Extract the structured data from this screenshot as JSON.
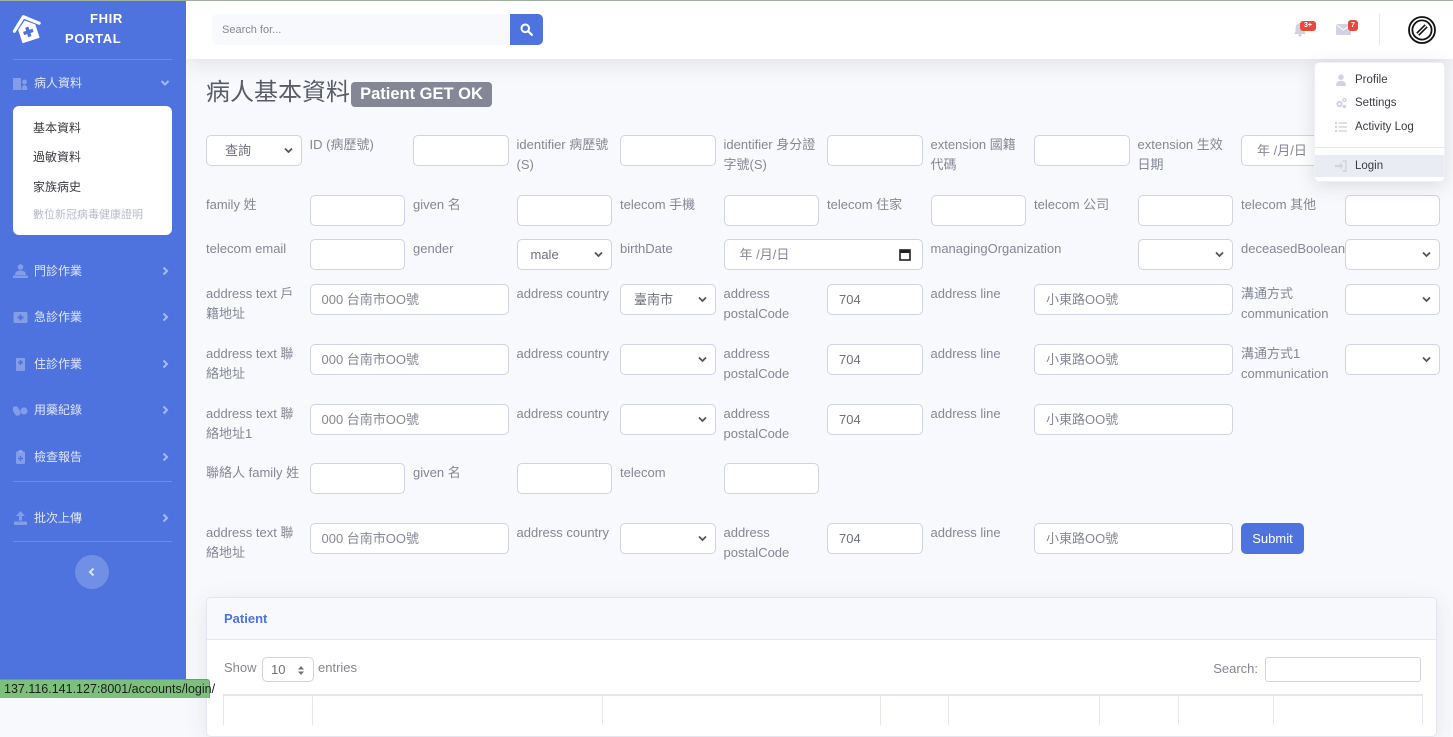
{
  "browser": {
    "status_url": "137.116.141.127:8001/accounts/login/"
  },
  "sidebar": {
    "brand": {
      "line1": "FHIR",
      "line2": "PORTAL",
      "icon": "clinic-medical-icon"
    },
    "patient_section": {
      "label": "病人資料",
      "icon": "hospital-user-icon",
      "expanded": true,
      "items": [
        {
          "label": "基本資料"
        },
        {
          "label": "過敏資料"
        },
        {
          "label": "家族病史"
        },
        {
          "label": "數位新冠病毒健康證明",
          "disabled": true
        }
      ]
    },
    "nav": [
      {
        "label": "門診作業",
        "icon": "user-injured-icon"
      },
      {
        "label": "急診作業",
        "icon": "medkit-icon"
      },
      {
        "label": "住診作業",
        "icon": "hospital-icon"
      },
      {
        "label": "用藥紀錄",
        "icon": "pills-icon"
      },
      {
        "label": "檢查報告",
        "icon": "file-medical-icon"
      },
      {
        "label": "批次上傳",
        "icon": "upload-icon"
      }
    ],
    "toggle_icon": "chevron-left-icon"
  },
  "topbar": {
    "search": {
      "placeholder": "Search for...",
      "value": ""
    },
    "alerts": {
      "icon": "bell-icon",
      "badge": "3+"
    },
    "messages": {
      "icon": "envelope-icon",
      "badge": "7"
    },
    "user_icon": "ban-icon",
    "user_menu": {
      "items": [
        {
          "label": "Profile",
          "icon": "user-icon"
        },
        {
          "label": "Settings",
          "icon": "cogs-icon"
        },
        {
          "label": "Activity Log",
          "icon": "list-icon"
        },
        {
          "label": "Login",
          "icon": "sign-in-icon",
          "active": true
        }
      ]
    }
  },
  "page": {
    "title": "病人基本資料",
    "status_badge": "Patient GET OK"
  },
  "form": {
    "mode": {
      "value": "查詢"
    },
    "id": {
      "label": "ID (病歷號)",
      "value": ""
    },
    "identifier_mrn": {
      "label": "identifier 病歷號(S)",
      "value": ""
    },
    "identifier_nid": {
      "label": "identifier 身分證字號(S)",
      "value": ""
    },
    "extension_nationality": {
      "label": "extension 國籍代碼",
      "value": ""
    },
    "extension_effective_date": {
      "label": "extension 生效日期",
      "placeholder": "年 /月/日"
    },
    "family": {
      "label": "family 姓",
      "value": ""
    },
    "given": {
      "label": "given 名",
      "value": ""
    },
    "telecom_mobile": {
      "label": "telecom 手機",
      "value": ""
    },
    "telecom_home": {
      "label": "telecom 住家",
      "value": ""
    },
    "telecom_work": {
      "label": "telecom 公司",
      "value": ""
    },
    "telecom_other": {
      "label": "telecom 其他",
      "value": ""
    },
    "telecom_email": {
      "label": "telecom email",
      "value": ""
    },
    "gender": {
      "label": "gender",
      "value": "male"
    },
    "birth_date": {
      "label": "birthDate",
      "placeholder": "年 /月/日"
    },
    "managing_organization": {
      "label": "managingOrganization",
      "value": ""
    },
    "deceased": {
      "label": "deceasedBoolean",
      "value": ""
    },
    "addresses": [
      {
        "text_label": "address text 戶籍地址",
        "text_placeholder": "000 台南市OO號",
        "country_label": "address country",
        "country_value": "臺南市",
        "postal_label": "address postalCode",
        "postal_value": "704",
        "line_label": "address line",
        "line_placeholder": "小東路OO號"
      },
      {
        "text_label": "address text 聯絡地址",
        "text_placeholder": "000 台南市OO號",
        "country_label": "address country",
        "country_value": "",
        "postal_label": "address postalCode",
        "postal_value": "704",
        "line_label": "address line",
        "line_placeholder": "小東路OO號"
      },
      {
        "text_label": "address text 聯絡地址1",
        "text_placeholder": "000 台南市OO號",
        "country_label": "address country",
        "country_value": "",
        "postal_label": "address postalCode",
        "postal_value": "704",
        "line_label": "address line",
        "line_placeholder": "小東路OO號"
      }
    ],
    "communication": [
      {
        "label": "溝通方式 communication",
        "value": ""
      },
      {
        "label": "溝通方式1 communication",
        "value": ""
      }
    ],
    "contact": {
      "family_label": "聯絡人 family 姓",
      "family_value": "",
      "given_label": "given 名",
      "given_value": "",
      "telecom_label": "telecom",
      "telecom_value": "",
      "address": {
        "text_label": "address text 聯絡地址",
        "text_placeholder": "000 台南市OO號",
        "country_label": "address country",
        "country_value": "",
        "postal_label": "address postalCode",
        "postal_value": "704",
        "line_label": "address line",
        "line_placeholder": "小東路OO號"
      }
    },
    "submit_label": "Submit"
  },
  "card": {
    "title": "Patient",
    "show_label": "Show",
    "page_length": "10",
    "entries_label": "entries",
    "search_label": "Search:",
    "search_value": ""
  }
}
